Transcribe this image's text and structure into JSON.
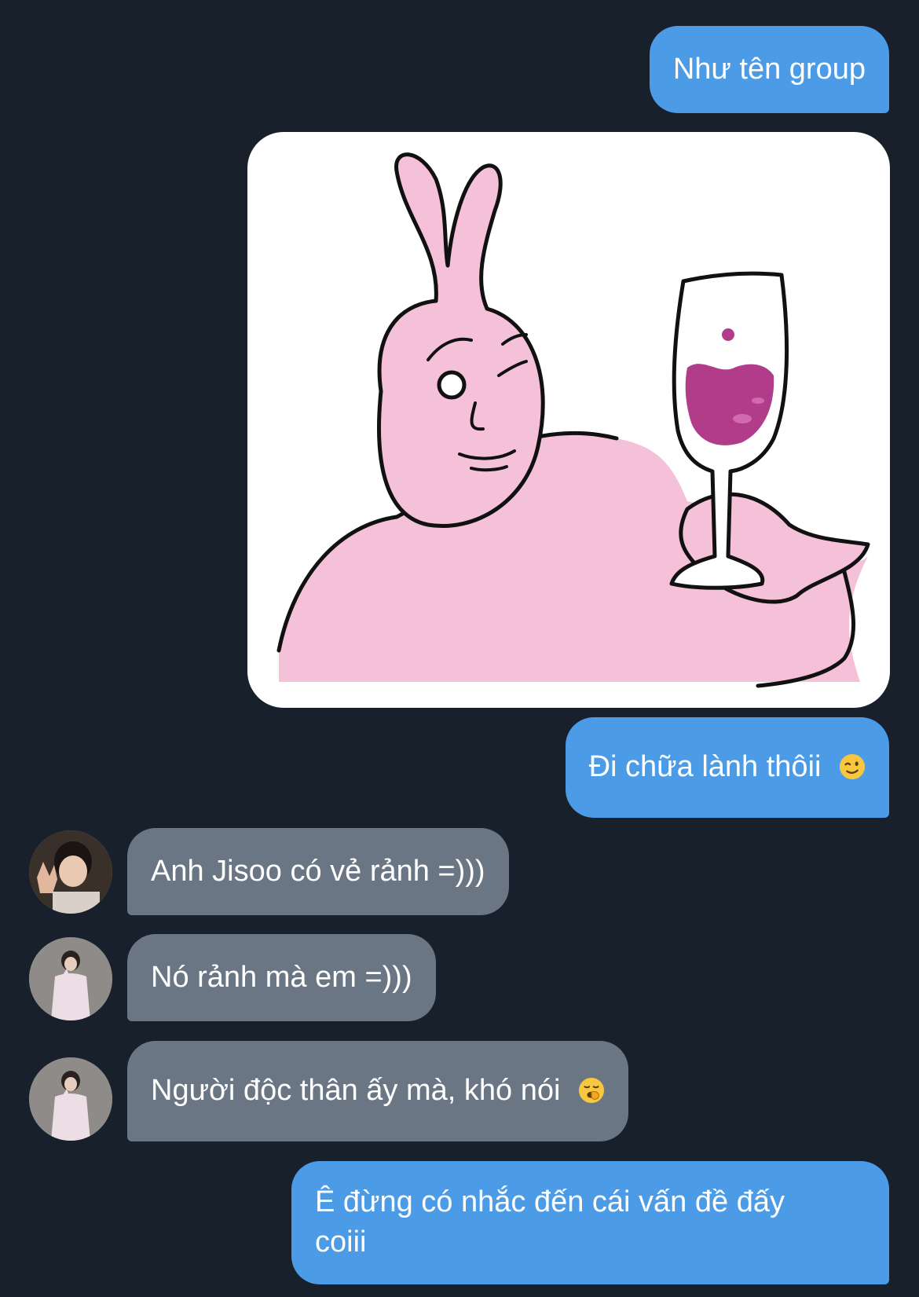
{
  "messages": [
    {
      "id": "m1",
      "direction": "outgoing",
      "text": "Như tên group"
    },
    {
      "id": "m2",
      "direction": "outgoing",
      "type": "sticker",
      "sticker": "pink-rabbit-wine-sticker"
    },
    {
      "id": "m3",
      "direction": "outgoing",
      "text": "Đi chữa lành thôii",
      "emoji": "winking-face-emoji"
    },
    {
      "id": "m4",
      "direction": "incoming",
      "text": "Anh Jisoo có vẻ rảnh =)))",
      "avatar": "sender-1-avatar"
    },
    {
      "id": "m5",
      "direction": "incoming",
      "text": "Nó rảnh mà em =)))",
      "avatar": "sender-2-avatar"
    },
    {
      "id": "m6",
      "direction": "incoming",
      "text": "Người độc thân ấy mà, khó nói",
      "emoji": "yawning-face-emoji",
      "avatar": "sender-2-avatar"
    },
    {
      "id": "m7",
      "direction": "outgoing",
      "text_lines": [
        "Ê đừng có nhắc đến cái vấn đề đấy",
        "coiii"
      ]
    }
  ],
  "colors": {
    "background": "#18202b",
    "outgoing_bubble": "#4c9be7",
    "incoming_bubble": "#6a7683",
    "text": "#ffffff",
    "sticker_pink": "#f4c1d8",
    "sticker_wine": "#b13c8a"
  }
}
